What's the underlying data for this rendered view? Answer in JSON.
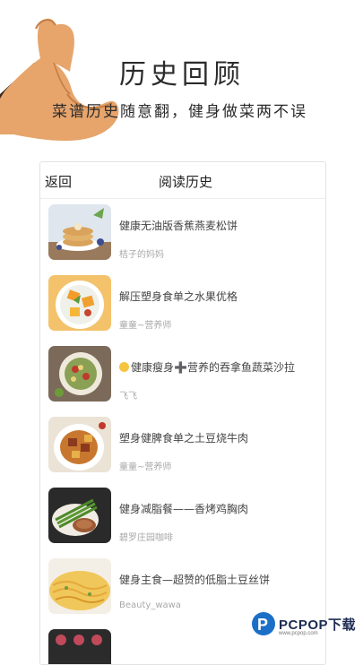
{
  "promo": {
    "title": "历史回顾",
    "subtitle": "菜谱历史随意翻，健身做菜两不误"
  },
  "screen": {
    "back_label": "返回",
    "title": "阅读历史"
  },
  "history": [
    {
      "title": "健康无油版香蕉燕麦松饼",
      "author": "桔子的妈妈"
    },
    {
      "title": "解压塑身食单之水果优格",
      "author": "童童~营养师"
    },
    {
      "title": "健康瘦身➕营养的吞拿鱼蔬菜沙拉",
      "author": "飞飞"
    },
    {
      "title": "塑身健脾食单之土豆烧牛肉",
      "author": "童童~营养师"
    },
    {
      "title": "健身减脂餐——香烤鸡胸肉",
      "author": "碧罗庄园咖啡"
    },
    {
      "title": "健身主食—超赞的低脂土豆丝饼",
      "author": "Beauty_wawa"
    },
    {
      "title": "",
      "author": ""
    }
  ],
  "watermark": {
    "logo_letter": "P",
    "name": "PCPOP下载",
    "url": "www.pcpop.com"
  },
  "colors": {
    "skin": "#e7a56c",
    "hair": "#3b2a1f",
    "brand_blue": "#1b6fc7"
  },
  "icons": [
    "flexed-arm-icon",
    "smile-emoji-icon",
    "pcpop-logo-icon"
  ]
}
